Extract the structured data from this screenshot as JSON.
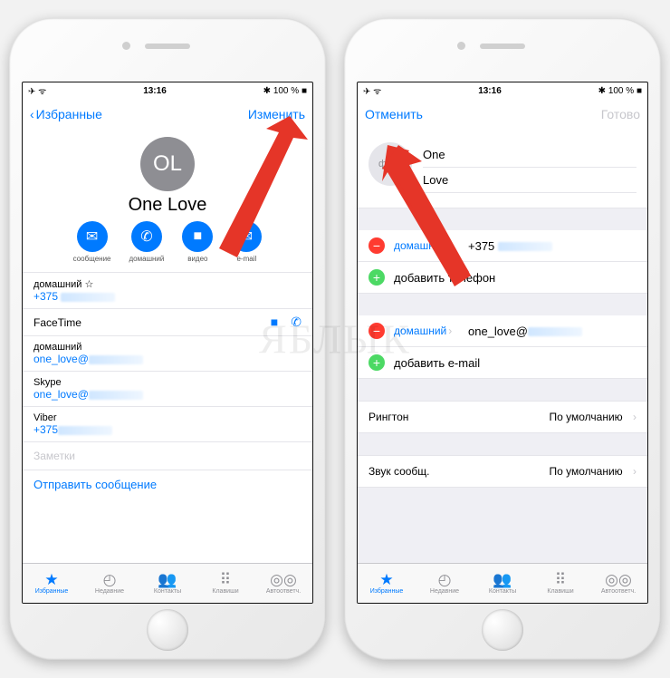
{
  "status": {
    "left": "✈ ᯤ",
    "time": "13:16",
    "right": "✱ 100 % ■"
  },
  "left": {
    "back": "Избранные",
    "edit": "Изменить",
    "initials": "OL",
    "name": "One Love",
    "apple": "",
    "actions": [
      {
        "icon": "✉",
        "label": "сообщение"
      },
      {
        "icon": "✆",
        "label": "домашний"
      },
      {
        "icon": "■",
        "label": "видео"
      },
      {
        "icon": "✉",
        "label": "e-mail"
      }
    ],
    "fields": [
      {
        "label": "домашний ☆",
        "value": "+375"
      },
      {
        "label_ft": "FaceTime"
      },
      {
        "label": "домашний",
        "value": "one_love@"
      },
      {
        "label": "Skype",
        "value": "one_love@"
      },
      {
        "label": "Viber",
        "value": "+375"
      }
    ],
    "notes": "Заметки",
    "send": "Отправить сообщение"
  },
  "right": {
    "cancel": "Отменить",
    "done": "Готово",
    "photo": "фото",
    "first": "One",
    "last": "Love",
    "apple": "",
    "phone_label": "домашний",
    "phone_value": "+375",
    "add_phone": "добавить телефон",
    "email_label": "домашний",
    "email_value": "one_love@",
    "add_email": "добавить e-mail",
    "ringtone_k": "Рингтон",
    "ringtone_v": "По умолчанию",
    "texttone_k": "Звук сообщ.",
    "texttone_v": "По умолчанию"
  },
  "tabs": [
    {
      "icon": "★",
      "label": "Избранные",
      "active": true
    },
    {
      "icon": "◴",
      "label": "Недавние"
    },
    {
      "icon": "👥",
      "label": "Контакты"
    },
    {
      "icon": "⠿",
      "label": "Клавиши"
    },
    {
      "icon": "◎◎",
      "label": "Автоответч."
    }
  ],
  "watermark": "ЯБЛЫК"
}
